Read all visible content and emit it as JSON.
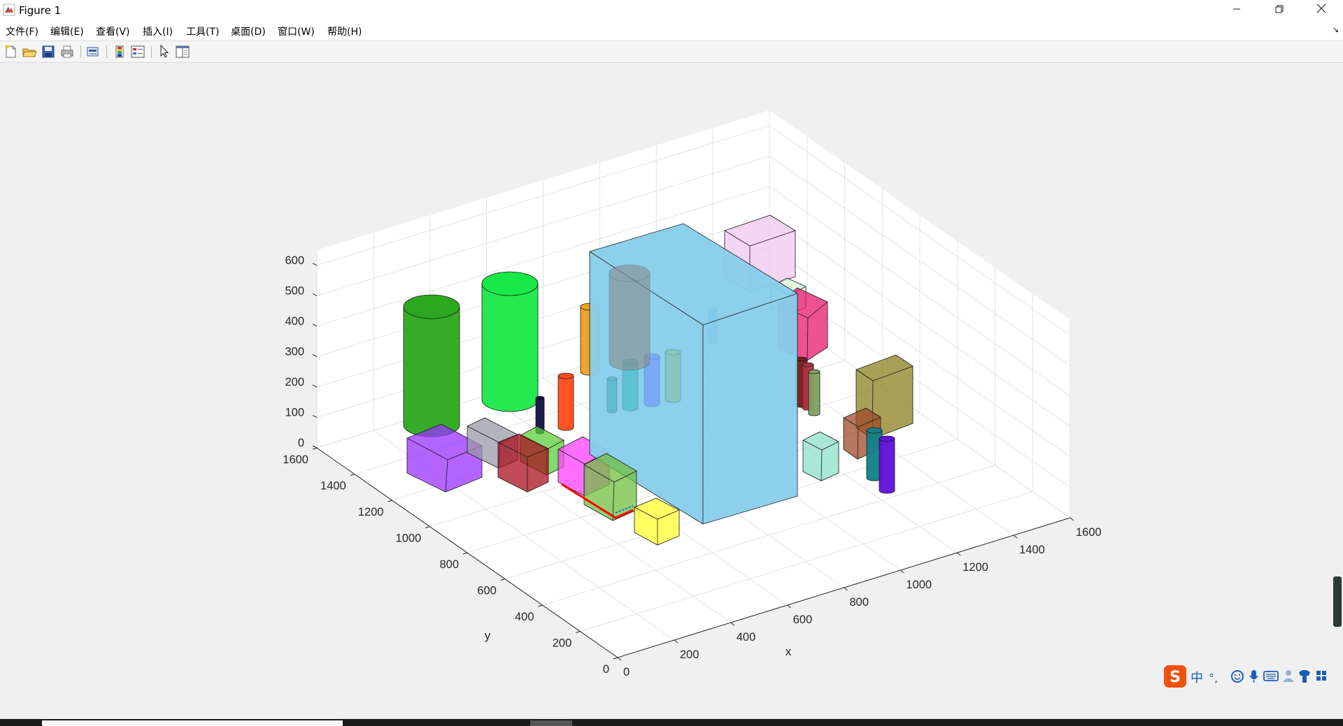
{
  "window": {
    "title": "Figure 1",
    "minimize_icon": "minimize-icon",
    "maximize_icon": "restore-icon",
    "close_icon": "close-icon"
  },
  "menubar": {
    "items": [
      "文件(F)",
      "编辑(E)",
      "查看(V)",
      "插入(I)",
      "工具(T)",
      "桌面(D)",
      "窗口(W)",
      "帮助(H)"
    ],
    "dock_arrow": "↘"
  },
  "toolbar": {
    "buttons": [
      "new-figure-icon",
      "open-file-icon",
      "save-icon",
      "print-icon",
      "link-plot-icon",
      "colorbar-icon",
      "legend-icon",
      "pointer-icon",
      "property-editor-icon"
    ]
  },
  "chart_data": {
    "type": "3d-scene",
    "xlabel": "x",
    "ylabel": "y",
    "zlabel": "",
    "xlim": [
      0,
      1600
    ],
    "ylim": [
      0,
      1600
    ],
    "zlim": [
      0,
      600
    ],
    "xticks": [
      "0",
      "200",
      "400",
      "600",
      "800",
      "1000",
      "1200",
      "1400",
      "1600"
    ],
    "yticks": [
      "0",
      "200",
      "400",
      "600",
      "800",
      "1000",
      "1200",
      "1400",
      "1600"
    ],
    "zticks": [
      "0",
      "100",
      "200",
      "300",
      "400",
      "500",
      "600"
    ],
    "grid": "on",
    "objects": [
      {
        "kind": "box",
        "color": "#87ceeb"
      },
      {
        "kind": "box",
        "color": "#f0c8f0"
      },
      {
        "kind": "box",
        "color": "#d6f5d6"
      },
      {
        "kind": "box",
        "color": "#e8186f"
      },
      {
        "kind": "box",
        "color": "#8c8020"
      },
      {
        "kind": "box",
        "color": "#a04a2a"
      },
      {
        "kind": "box",
        "color": "#8ee0c8"
      },
      {
        "kind": "box",
        "color": "#9b30ff"
      },
      {
        "kind": "box",
        "color": "#9a9aaa"
      },
      {
        "kind": "box",
        "color": "#aa1020"
      },
      {
        "kind": "box",
        "color": "#5ccf3a"
      },
      {
        "kind": "box",
        "color": "#ff40ff"
      },
      {
        "kind": "box",
        "color": "#70c040"
      },
      {
        "kind": "box",
        "color": "#ffff30"
      },
      {
        "kind": "cylinder",
        "color": "#2ca81e"
      },
      {
        "kind": "cylinder",
        "color": "#18e848"
      },
      {
        "kind": "cylinder",
        "color": "#f0a020"
      },
      {
        "kind": "cylinder",
        "color": "#ff4a1a"
      },
      {
        "kind": "cylinder",
        "color": "#101040"
      },
      {
        "kind": "cylinder",
        "color": "#4aaec0"
      },
      {
        "kind": "cylinder",
        "color": "#40b8c8"
      },
      {
        "kind": "cylinder",
        "color": "#7090ff"
      },
      {
        "kind": "cylinder",
        "color": "#80c0a0"
      },
      {
        "kind": "cylinder",
        "color": "#8a8a8a"
      },
      {
        "kind": "cylinder",
        "color": "#2a90d8"
      },
      {
        "kind": "cylinder",
        "color": "#7a1a1a"
      },
      {
        "kind": "cylinder",
        "color": "#b03040"
      },
      {
        "kind": "cylinder",
        "color": "#80a060"
      },
      {
        "kind": "cylinder",
        "color": "#10808a"
      },
      {
        "kind": "cylinder",
        "color": "#6010d8"
      }
    ]
  },
  "ime": {
    "logo": "sogou-logo-icon",
    "mode_label": "中",
    "punct_label": "°,",
    "icons": [
      "emoji-icon",
      "microphone-icon",
      "keyboard-icon",
      "user-icon",
      "skin-icon",
      "apps-icon"
    ]
  }
}
